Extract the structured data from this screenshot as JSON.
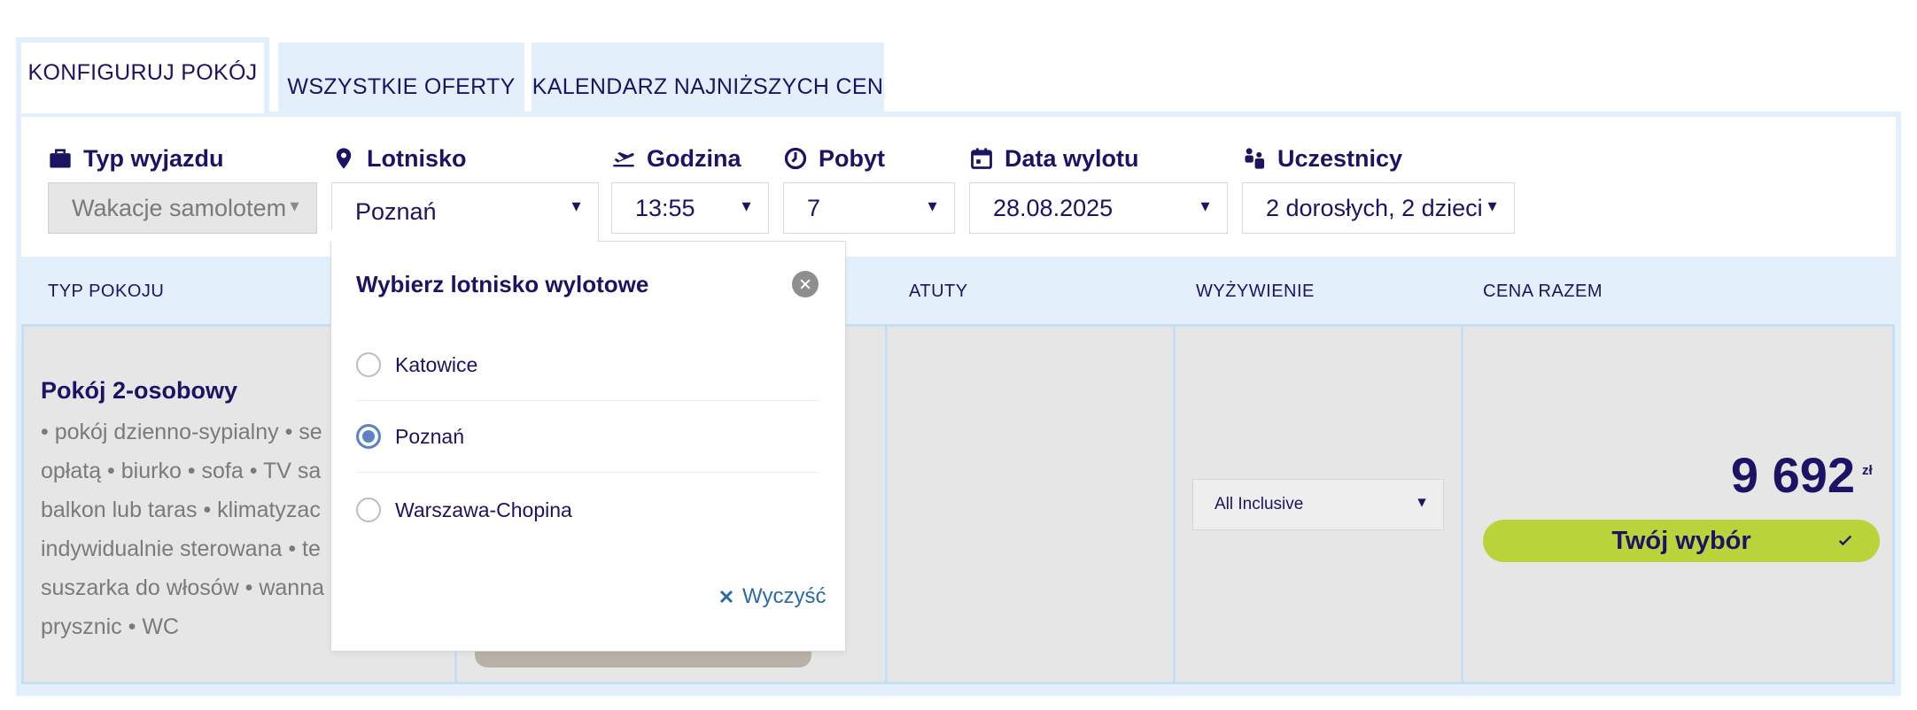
{
  "tabs": [
    {
      "label": "KONFIGURUJ POKÓJ",
      "active": true
    },
    {
      "label": "WSZYSTKIE OFERTY",
      "active": false
    },
    {
      "label": "KALENDARZ NAJNIŻSZYCH CEN",
      "active": false
    }
  ],
  "filters": {
    "trip_type": {
      "label": "Typ wyjazdu",
      "value": "Wakacje samolotem",
      "icon": "briefcase-icon",
      "disabled": true
    },
    "airport": {
      "label": "Lotnisko",
      "value": "Poznań",
      "icon": "map-pin-icon"
    },
    "time": {
      "label": "Godzina",
      "value": "13:55",
      "icon": "plane-departure-icon"
    },
    "stay": {
      "label": "Pobyt",
      "value": "7",
      "icon": "clock-icon"
    },
    "date": {
      "label": "Data wylotu",
      "value": "28.08.2025",
      "icon": "calendar-icon"
    },
    "participants": {
      "label": "Uczestnicy",
      "value": "2 dorosłych, 2 dzieci",
      "icon": "people-icon"
    }
  },
  "table": {
    "headers": {
      "room_type": "TYP POKOJU",
      "perks": "ATUTY",
      "board": "WYŻYWIENIE",
      "price": "CENA RAZEM"
    },
    "row": {
      "room_title": "Pokój 2-osobowy",
      "room_desc": "• pokój dzienno-sypialny • sejf za opłatą • biurko • sofa • TV sat • balkon lub taras • klimatyzacja indywidualnie sterowana • telefon • suszarka do włosów • wanna lub prysznic • WC",
      "room_desc_lines": [
        "• pokój dzienno-sypialny • se",
        "opłatą • biurko • sofa • TV sa",
        "balkon lub taras • klimatyzac",
        "indywidualnie sterowana • te",
        "suszarka do włosów • wanna",
        "prysznic • WC"
      ],
      "board": "All Inclusive",
      "price": "9 692",
      "currency": "zł",
      "choice_label": "Twój wybór"
    }
  },
  "airport_popup": {
    "title": "Wybierz lotnisko wylotowe",
    "options": [
      {
        "label": "Katowice",
        "selected": false
      },
      {
        "label": "Poznań",
        "selected": true
      },
      {
        "label": "Warszawa-Chopina",
        "selected": false
      }
    ],
    "clear_label": "Wyczyść"
  },
  "colors": {
    "navy": "#1b1464",
    "light_blue": "#e3f0fb",
    "accent_green": "#b9d43a",
    "link_blue": "#2a6aa8"
  }
}
